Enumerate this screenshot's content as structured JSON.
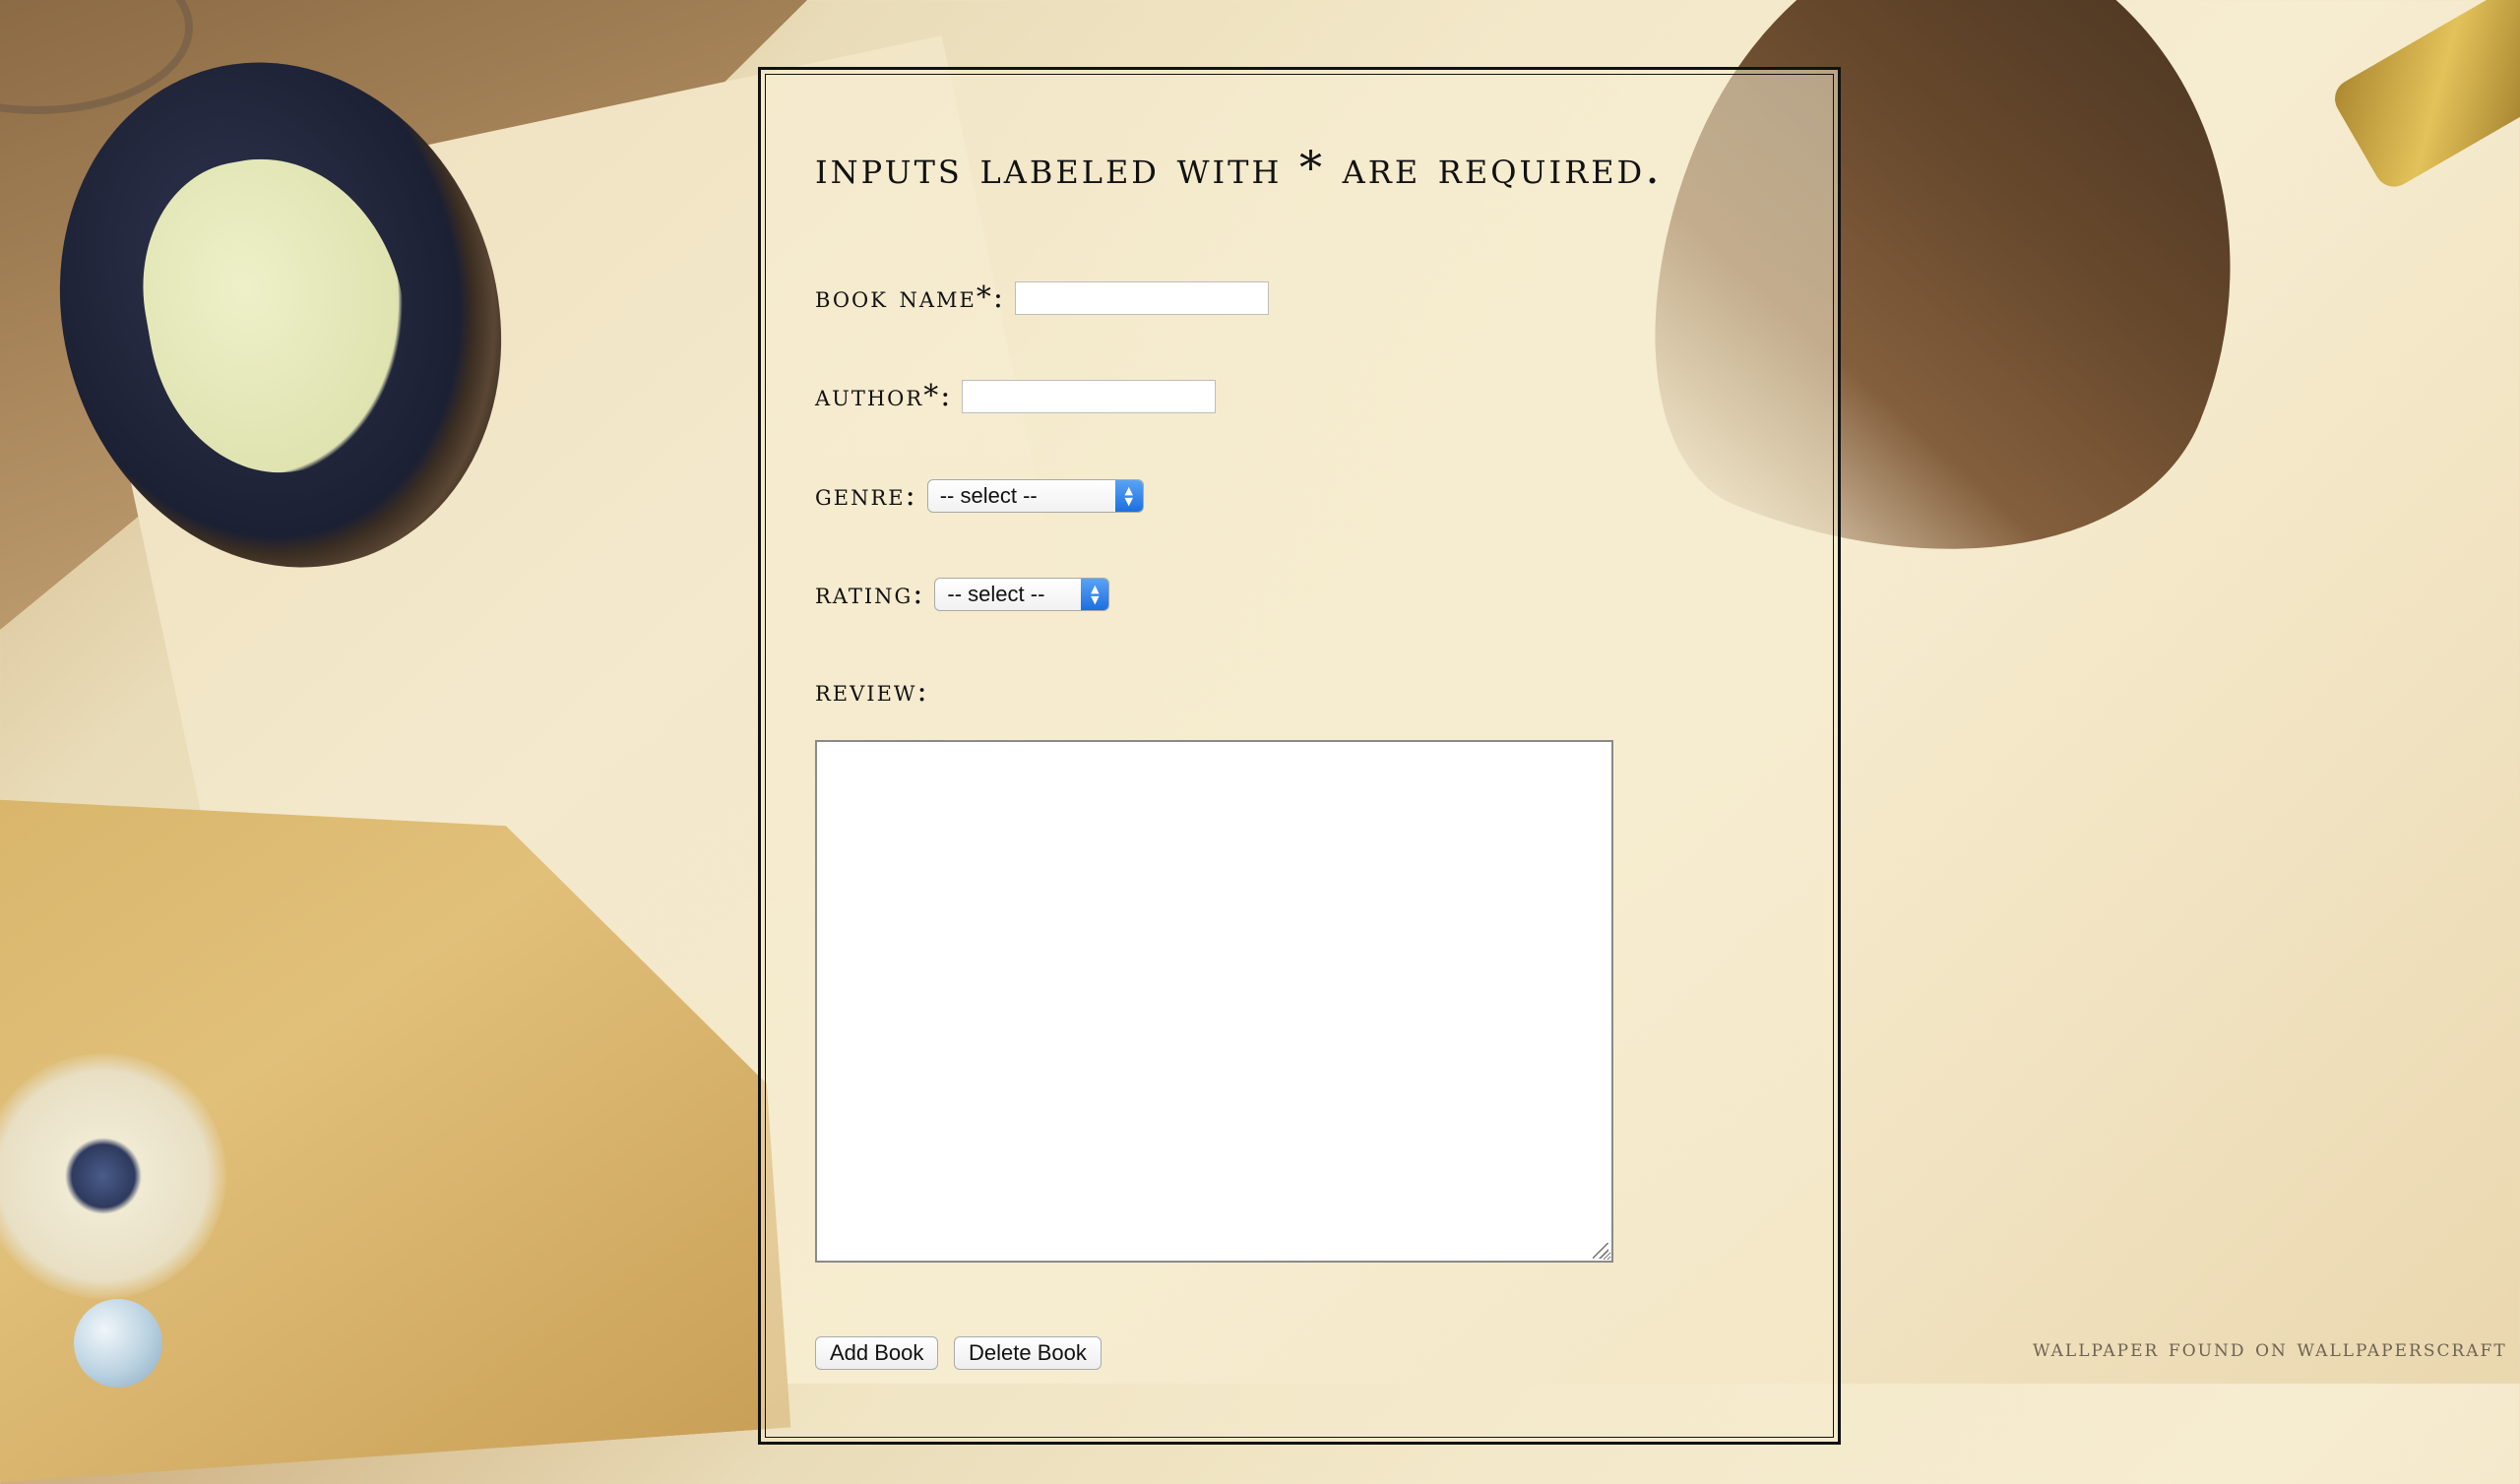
{
  "form": {
    "heading": "Inputs labeled with * are required.",
    "book_name_label": "Book Name*:",
    "book_name_value": "",
    "author_label": "Author*:",
    "author_value": "",
    "genre_label": "Genre:",
    "genre_selected": "-- select --",
    "rating_label": "Rating:",
    "rating_selected": "-- select --",
    "review_label": "Review:",
    "review_value": "",
    "add_button": "Add Book",
    "delete_button": "Delete Book"
  },
  "footer": {
    "credit": "Wallpaper found on WallpapersCraft"
  },
  "icons": {
    "select_arrow": "updown-chevron-icon",
    "resize_grip": "resize-grip-icon"
  },
  "colors": {
    "select_accent": "#1b6fe0",
    "text": "#111111",
    "panel_border": "#111111"
  }
}
